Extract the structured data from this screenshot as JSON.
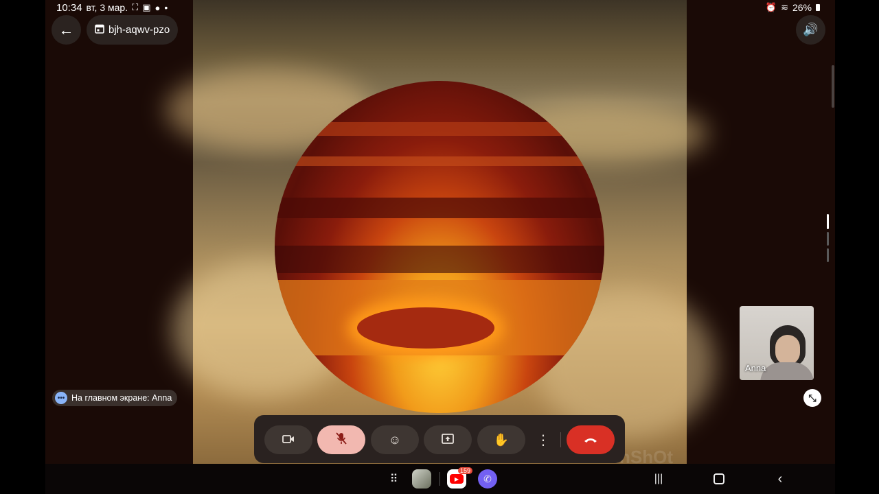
{
  "status_bar": {
    "time": "10:34",
    "date": "вт, 3 мар.",
    "dot": "•",
    "battery": "26%"
  },
  "header": {
    "meeting_code": "bjh-aqwv-pzo"
  },
  "presenter_chip": {
    "text": "На главном экране: Anna"
  },
  "self_view": {
    "name": "Anna"
  },
  "watermark": "InShOt",
  "taskbar": {
    "youtube_badge": "159"
  },
  "colors": {
    "end_call": "#d93025",
    "mic_off_bg": "#f2b8b0",
    "control_bar": "#2a2220"
  },
  "icons": [
    "back-arrow-icon",
    "calendar-icon",
    "volume-icon",
    "camera-icon",
    "mic-off-icon",
    "emoji-icon",
    "present-icon",
    "raise-hand-icon",
    "more-vert-icon",
    "hang-up-icon",
    "collapse-icon",
    "apps-grid-icon",
    "recent-apps-icon",
    "home-icon",
    "nav-back-icon"
  ]
}
